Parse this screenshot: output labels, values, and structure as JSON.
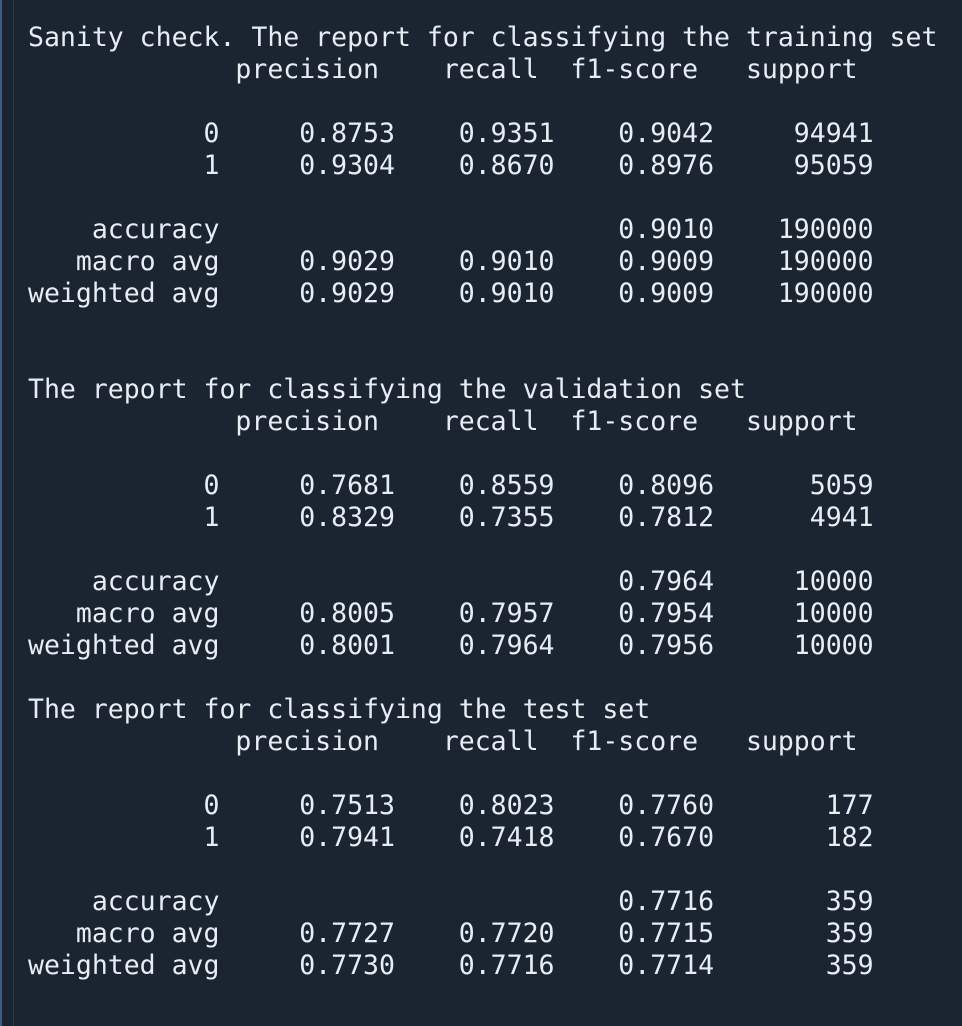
{
  "lines": [
    "Sanity check. The report for classifying the training set",
    "             precision    recall  f1-score   support",
    "",
    "           0     0.8753    0.9351    0.9042     94941",
    "           1     0.9304    0.8670    0.8976     95059",
    "",
    "    accuracy                         0.9010    190000",
    "   macro avg     0.9029    0.9010    0.9009    190000",
    "weighted avg     0.9029    0.9010    0.9009    190000",
    "",
    "",
    "The report for classifying the validation set",
    "             precision    recall  f1-score   support",
    "",
    "           0     0.7681    0.8559    0.8096      5059",
    "           1     0.8329    0.7355    0.7812      4941",
    "",
    "    accuracy                         0.7964     10000",
    "   macro avg     0.8005    0.7957    0.7954     10000",
    "weighted avg     0.8001    0.7964    0.7956     10000",
    "",
    "The report for classifying the test set",
    "             precision    recall  f1-score   support",
    "",
    "           0     0.7513    0.8023    0.7760       177",
    "           1     0.7941    0.7418    0.7670       182",
    "",
    "    accuracy                         0.7716       359",
    "   macro avg     0.7727    0.7720    0.7715       359",
    "weighted avg     0.7730    0.7716    0.7714       359"
  ]
}
